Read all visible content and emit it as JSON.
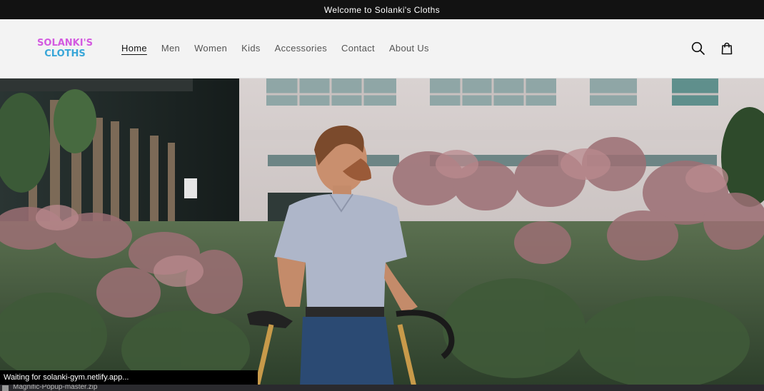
{
  "announcement": "Welcome to Solanki's Cloths",
  "logo": {
    "line1": "SOLANKI'S",
    "line2": "CLOTHS"
  },
  "nav": {
    "items": [
      {
        "label": "Home",
        "active": true
      },
      {
        "label": "Men"
      },
      {
        "label": "Women"
      },
      {
        "label": "Kids"
      },
      {
        "label": "Accessories"
      },
      {
        "label": "Contact"
      },
      {
        "label": "About Us"
      }
    ]
  },
  "icons": {
    "search": "search-icon",
    "cart": "cart-icon"
  },
  "hero": {
    "image": "hero-image"
  },
  "status_bar": {
    "text": "Waiting for solanki-gym.netlify.app..."
  },
  "downloads_bar": {
    "file_name": "Magnific-Popup-master.zip"
  },
  "colors": {
    "announcement_bg": "#121212",
    "header_bg": "#f3f3f3",
    "logo_pink": "#d35ae0",
    "logo_blue": "#38a6d8"
  }
}
